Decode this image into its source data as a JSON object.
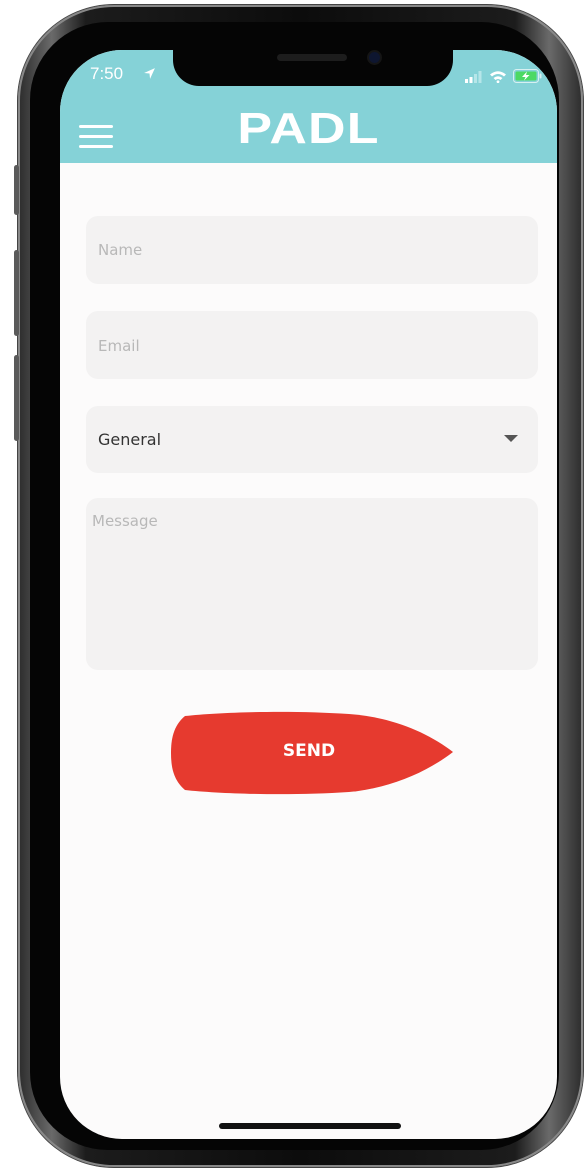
{
  "status_bar": {
    "time": "7:50",
    "location_icon": "location-arrow-icon",
    "icons": [
      "signal-icon",
      "wifi-icon",
      "battery-charging-icon"
    ]
  },
  "header": {
    "menu_icon": "hamburger-menu-icon",
    "logo": "PADL",
    "background_color": "#85d2d7"
  },
  "form": {
    "name": {
      "placeholder": "Name",
      "value": ""
    },
    "email": {
      "placeholder": "Email",
      "value": ""
    },
    "topic": {
      "selected": "General",
      "icon": "caret-down-icon"
    },
    "message": {
      "placeholder": "Message",
      "value": ""
    },
    "send_label": "SEND",
    "send_color": "#e63a2f"
  }
}
